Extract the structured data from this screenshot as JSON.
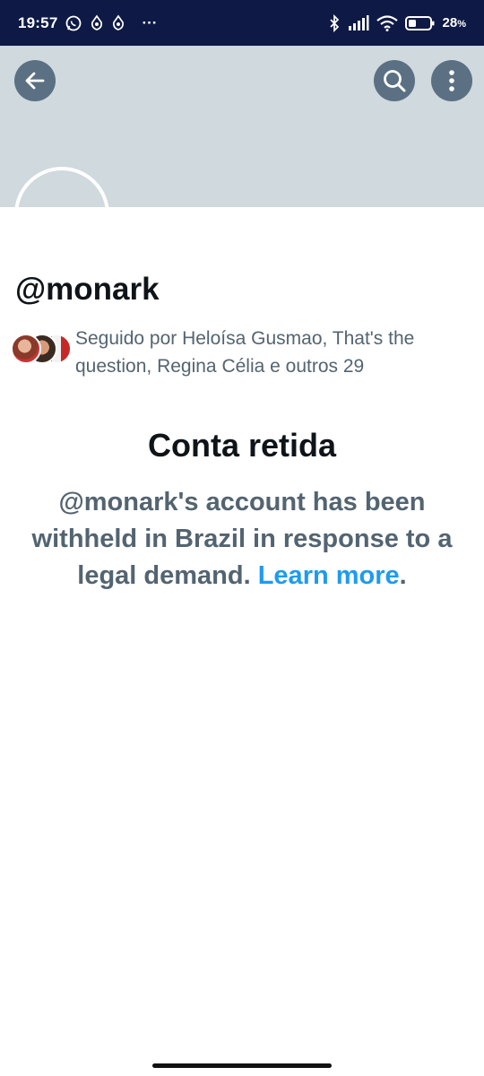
{
  "status_bar": {
    "time": "19:57",
    "battery_pct": "28",
    "battery_suffix": "%",
    "overflow": "···",
    "icons": [
      "whatsapp-icon",
      "app-notification-icon",
      "app-notification-icon",
      "bluetooth-icon",
      "signal-icon",
      "wifi-icon",
      "battery-icon"
    ]
  },
  "header": {
    "icons": [
      "back-arrow-icon",
      "search-icon",
      "more-vertical-icon"
    ]
  },
  "profile": {
    "handle": "@monark",
    "followed_by": "Seguido por Heloísa Gusmao, That's the question, Regina Célia e outros 29"
  },
  "withheld": {
    "title": "Conta retida",
    "message": "@monark's account has been withheld in Brazil in response to a legal demand.",
    "link": "Learn more",
    "end": "."
  },
  "colors": {
    "status_bar": "#0e1a45",
    "banner": "#cfd9de",
    "button": "#5b7083",
    "text_primary": "#0f1419",
    "text_secondary": "#536471",
    "link": "#1d9bf0"
  }
}
